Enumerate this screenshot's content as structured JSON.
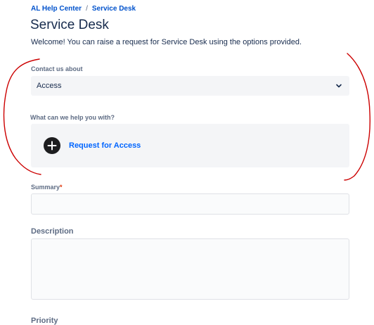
{
  "breadcrumb": {
    "home": "AL Help Center",
    "separator": "/",
    "current": "Service Desk"
  },
  "page": {
    "title": "Service Desk",
    "welcome": "Welcome! You can raise a request for Service Desk using the options provided."
  },
  "contact": {
    "label": "Contact us about",
    "selected": "Access",
    "chevron_icon": "chevron-down-icon"
  },
  "help": {
    "label": "What can we help you with?",
    "option_label": "Request for Access",
    "option_icon": "add-circle-icon"
  },
  "summary": {
    "label": "Summary",
    "required_mark": "*",
    "value": ""
  },
  "description": {
    "label": "Description",
    "value": ""
  },
  "priority": {
    "label": "Priority"
  },
  "colors": {
    "link": "#0052cc",
    "field_bg": "#f4f5f7",
    "annotation": "#cc0000",
    "required": "#de350b"
  }
}
